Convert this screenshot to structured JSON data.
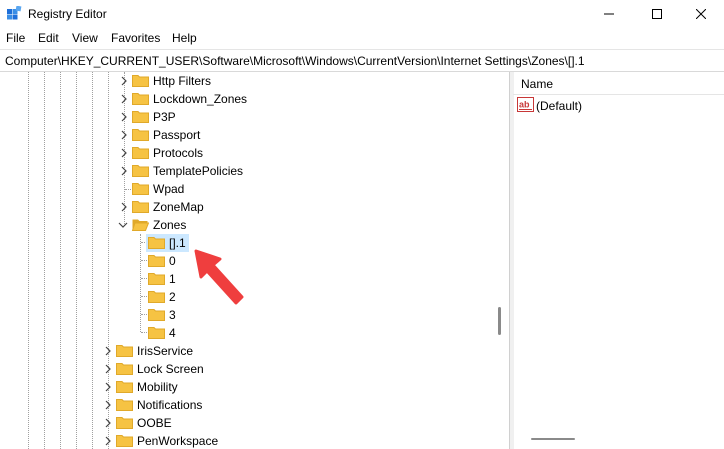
{
  "window": {
    "title": "Registry Editor"
  },
  "menu": [
    "File",
    "Edit",
    "View",
    "Favorites",
    "Help"
  ],
  "address": "Computer\\HKEY_CURRENT_USER\\Software\\Microsoft\\Windows\\CurrentVersion\\Internet Settings\\Zones\\[].1",
  "tree": {
    "upper_items": [
      "Http Filters",
      "Lockdown_Zones",
      "P3P",
      "Passport",
      "Protocols",
      "TemplatePolicies",
      "Wpad",
      "ZoneMap"
    ],
    "zones_label": "Zones",
    "zone_children": [
      "[].1",
      "0",
      "1",
      "2",
      "3",
      "4"
    ],
    "selected": "[].1",
    "lower_items": [
      "IrisService",
      "Lock Screen",
      "Mobility",
      "Notifications",
      "OOBE",
      "PenWorkspace"
    ]
  },
  "values_pane": {
    "column_name": "Name",
    "rows": [
      {
        "name": "(Default)",
        "icon": "reg-sz-icon"
      }
    ]
  },
  "colors": {
    "folder": "#f6c343",
    "folder_dark": "#e0a92a",
    "selection": "#cce8ff",
    "annotation_arrow": "#ef3e3e"
  }
}
